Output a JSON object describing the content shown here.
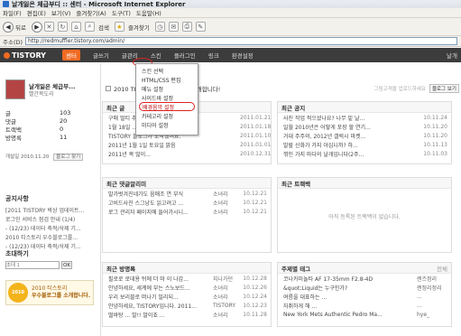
{
  "window": {
    "title": "날개잃은 체급부디 :: 센터 - Microsoft Internet Explorer"
  },
  "menubar": [
    "파일(F)",
    "편집(E)",
    "보기(V)",
    "즐겨찾기(A)",
    "도구(T)",
    "도움말(H)"
  ],
  "toolbar": {
    "back": "뒤로",
    "search": "검색",
    "favorites": "즐겨찾기"
  },
  "address": {
    "label": "주소(D)",
    "url": "http://redmuffler.tistory.com/admin/"
  },
  "tnav": {
    "logo": "TISTORY",
    "items": [
      "센터",
      "글쓰기",
      "글관리",
      "스킨",
      "플러그인",
      "링크",
      "환경설정"
    ],
    "right": "날개"
  },
  "dropdown": {
    "items": [
      "스킨 선택",
      "HTML/CSS 편집",
      "메뉴 설정",
      "사이드바 설정",
      "배경음악 설정",
      "카테고리 설정",
      "미디어 설정"
    ],
    "circled_index": 4
  },
  "profile": {
    "name": "날개잃은 체급부...",
    "id": "빨간목도리",
    "avatar_color": "#b44444"
  },
  "stats": [
    {
      "k": "글",
      "v": "103"
    },
    {
      "k": "댓글",
      "v": "20"
    },
    {
      "k": "트랙백",
      "v": "0"
    },
    {
      "k": "방명록",
      "v": "11"
    }
  ],
  "opened": {
    "text": "개설일 2010.11.20",
    "button": "블로그 찾기"
  },
  "notice": {
    "title": "공지사항",
    "items": [
      "[2011 TISTORY 박상 업데이트...",
      "로그인 서비스 점검 안내 (1/4)",
      "- (12/23) 데이터 축적/삭제 기...",
      "2010 티스토리 우수블로그를...",
      "- (12/23) 데이터 축적/삭제 기..."
    ]
  },
  "invite": {
    "title": "초대하기",
    "placeholder": "초대 1",
    "ok": "OK"
  },
  "award": {
    "badge": "2010",
    "line1": "2010 티스토리",
    "line2": "우수블로그를 소개합니다."
  },
  "bar2010": {
    "text": "2010 TISTORY 우수블로그를 소개합니다!",
    "r1": "그림고객을 업로드하세요",
    "r2": "블로그 보기"
  },
  "recent_posts": {
    "title": "최근 글",
    "rows": [
      {
        "t": "구매 멀티 추가 시작가 주...",
        "a": "",
        "d": "2011.01.21"
      },
      {
        "t": "1월 18일 ...",
        "a": "",
        "d": "2011.01.18"
      },
      {
        "t": "TISTORY 블로그가 도착했어요.",
        "a": "",
        "d": "2011.01.10"
      },
      {
        "t": "2011년 1월 1일 토요일 맑음",
        "a": "",
        "d": "2011.01.01"
      },
      {
        "t": "2011년 복 많이...",
        "a": "",
        "d": "2010.12.31"
      }
    ]
  },
  "recent_notice": {
    "title": "최근 공지",
    "rows": [
      {
        "t": "사진 작업 적으셨나요? 나무 밑 날...",
        "a": "",
        "d": "10.11.24"
      },
      {
        "t": "일월 2010년은 어떻게 포장 할 연기...",
        "a": "",
        "d": "10.11.20"
      },
      {
        "t": "거대 주주의, 2012년 갤럭시 마켓...",
        "a": "",
        "d": "10.11.20"
      },
      {
        "t": "발랄 신화가 가지 아십니까? 하...",
        "a": "",
        "d": "10.11.13"
      },
      {
        "t": "꺾인 가지 마다의 날개입니다(2주...",
        "a": "",
        "d": "10.11.03"
      }
    ]
  },
  "recent_comments": {
    "title": "최근 댓글알리미",
    "rows": [
      {
        "t": "발가벗겨진네가도 음매조 연 부식",
        "a": "소녀리",
        "d": "10.12.21"
      },
      {
        "t": "고비드사진 스그냥도 읽고려고 ...",
        "a": "소녀리",
        "d": "10.12.21"
      },
      {
        "t": "로그 관리자 페이지에 들어가시니...",
        "a": "소녀리",
        "d": "10.12.21"
      }
    ]
  },
  "recent_trackbacks": {
    "title": "최근 트랙백",
    "empty": "아직 등록된 트랙백이 없습니다."
  },
  "recent_guest": {
    "title": "최근 방명록",
    "rows": [
      {
        "t": "필로로 로데용 뒤에 더 마 이 나갑...",
        "a": "지나가던",
        "d": "10.12.28"
      },
      {
        "t": "안녕하세요, 세계에 부는 스노보드...",
        "a": "소녀리",
        "d": "10.12.26"
      },
      {
        "t": "우리 보리블로 떠나기 밀리되...",
        "a": "소녀리",
        "d": "10.12.24"
      },
      {
        "t": "안녕하세요, TISTORY입니다. 2011...",
        "a": "TISTORY",
        "d": "10.12.23"
      },
      {
        "t": "떨바탕 ... 발!! 말이죠 ...",
        "a": "소녀리",
        "d": "10.11.28"
      }
    ]
  },
  "topic_tags": {
    "title": "주제별 태그",
    "tab": "전체",
    "rows": [
      {
        "t": "코나카미놀타 AF 17-35mm F2.8-4D",
        "a": "렌즈정리",
        "d": ""
      },
      {
        "t": "&quot;Liquid는 누구인가?",
        "a": "렌정리정리",
        "d": ""
      },
      {
        "t": "여름을 대표하는 ...",
        "a": "...",
        "d": ""
      },
      {
        "t": "자취하게 해 ...",
        "a": "...",
        "d": ""
      },
      {
        "t": "New York Mets Authentic Pedro Ma...",
        "a": "hye_",
        "d": ""
      }
    ]
  }
}
